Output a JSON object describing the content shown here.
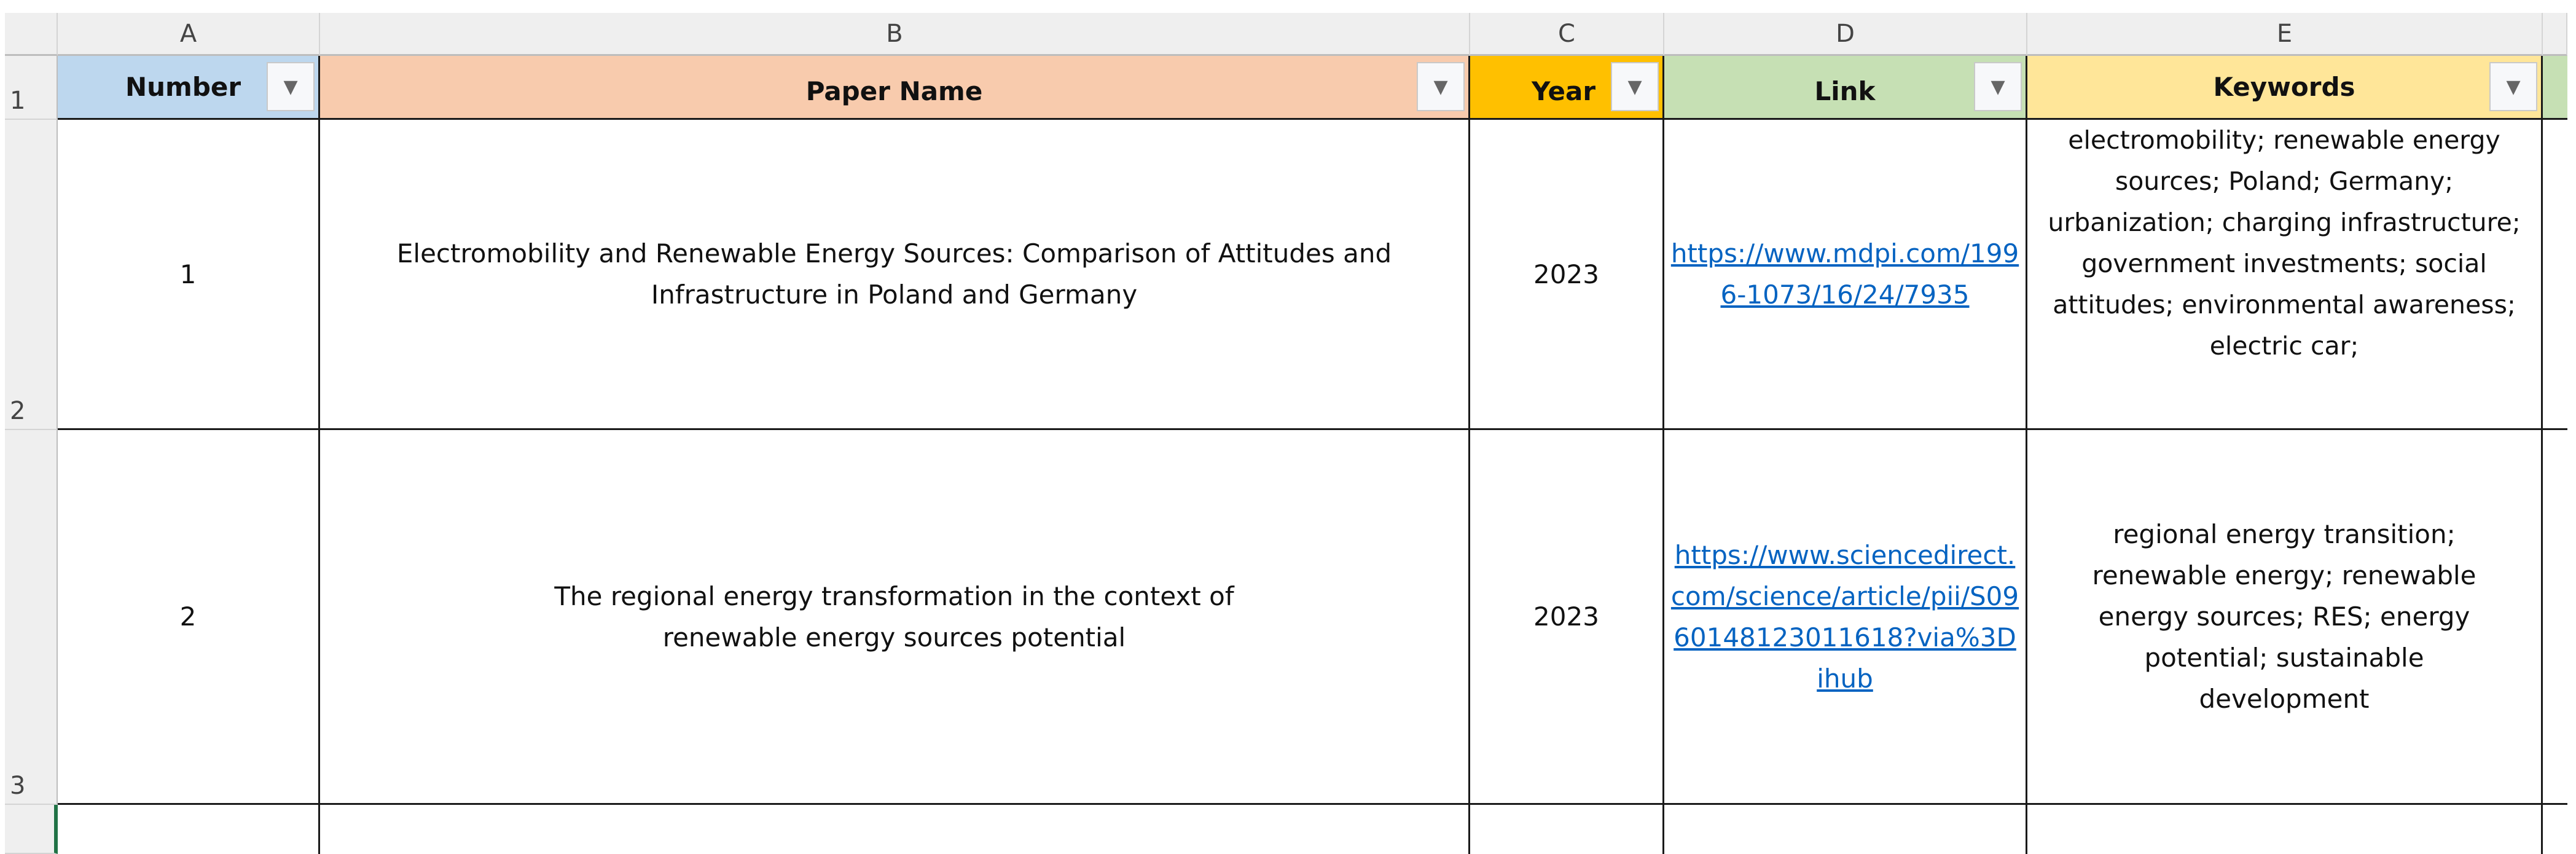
{
  "column_headers": [
    "A",
    "B",
    "C",
    "D",
    "E"
  ],
  "row_headers": [
    "1",
    "2",
    "3"
  ],
  "table_headers": {
    "number": "Number",
    "paper_name": "Paper Name",
    "year": "Year",
    "link": "Link",
    "keywords": "Keywords"
  },
  "header_colors": {
    "number": "#bdd7ee",
    "paper_name": "#f8cbad",
    "year": "#ffc000",
    "link": "#c6e0b4",
    "keywords": "#ffe699"
  },
  "rows": [
    {
      "number": "1",
      "paper_name": "Electromobility and Renewable Energy Sources: Comparison of Attitudes and Infrastructure in Poland and Germany",
      "year": "2023",
      "link": "https://www.mdpi.com/1996-1073/16/24/7935",
      "keywords": "electromobility; renewable energy sources; Poland; Germany; urbanization; charging infrastructure; government investments; social attitudes; environmental awareness; electric car;"
    },
    {
      "number": "2",
      "paper_name": "The regional energy transformation in the context of renewable energy sources potential",
      "year": "2023",
      "link": "https://www.sciencedirect.com/science/article/pii/S0960148123011618?via%3Dihub",
      "keywords": "regional energy transition; renewable energy; renewable energy sources; RES; energy potential; sustainable development"
    }
  ]
}
